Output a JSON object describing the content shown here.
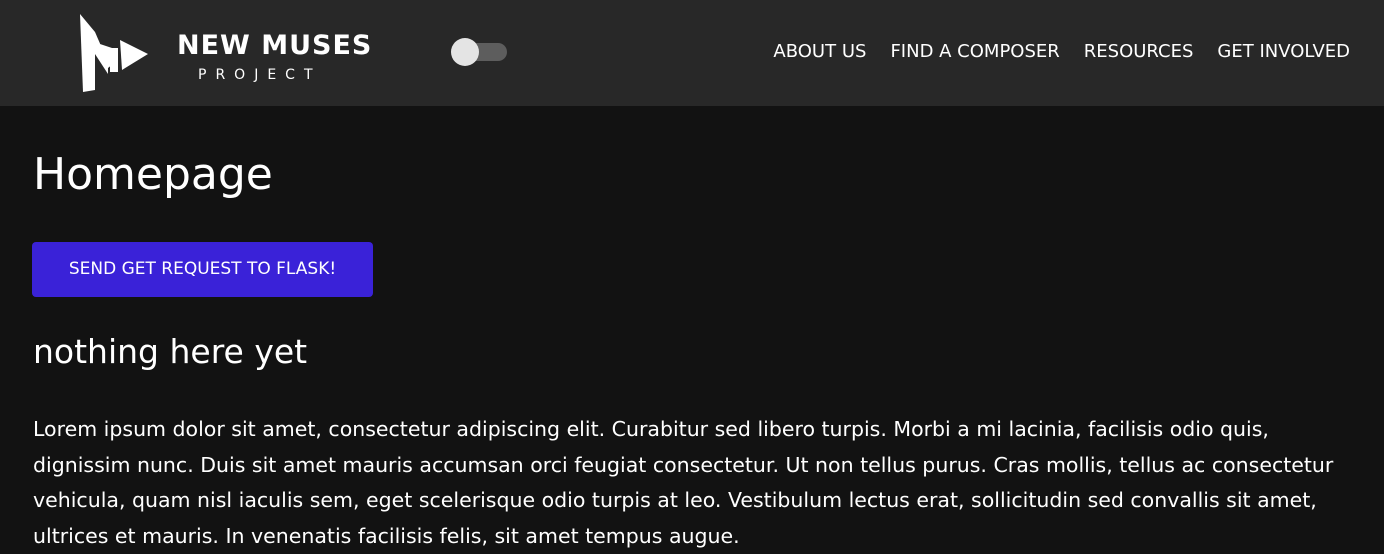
{
  "header": {
    "logo": {
      "title": "NEW MUSES",
      "subtitle": "PROJECT"
    },
    "theme_toggle": {
      "state": "off"
    },
    "nav": [
      {
        "label": "ABOUT US"
      },
      {
        "label": "FIND A COMPOSER"
      },
      {
        "label": "RESOURCES"
      },
      {
        "label": "GET INVOLVED"
      }
    ]
  },
  "main": {
    "title": "Homepage",
    "button_label": "SEND GET REQUEST TO FLASK!",
    "subheading": "nothing here yet",
    "body": "Lorem ipsum dolor sit amet, consectetur adipiscing elit. Curabitur sed libero turpis. Morbi a mi lacinia, facilisis odio quis, dignissim nunc. Duis sit amet mauris accumsan orci feugiat consectetur. Ut non tellus purus. Cras mollis, tellus ac consectetur vehicula, quam nisl iaculis sem, eget scelerisque odio turpis at leo. Vestibulum lectus erat, sollicitudin sed convallis sit amet, ultrices et mauris. In venenatis facilisis felis, sit amet tempus augue."
  },
  "colors": {
    "page_background": "#121212",
    "navbar_background": "#282828",
    "button_accent": "#3a22d8",
    "text": "#ffffff"
  },
  "icons": {
    "logo_mark": "nm-logo-icon"
  }
}
